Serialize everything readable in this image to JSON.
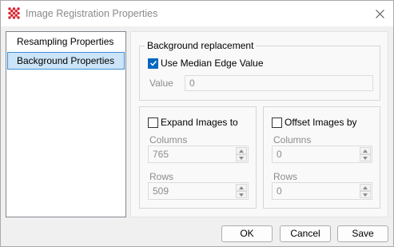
{
  "window": {
    "title": "Image Registration Properties"
  },
  "icons": {
    "app": "red-grid-app-icon",
    "close": "close-icon"
  },
  "sidebar": {
    "items": [
      {
        "label": "Resampling Properties",
        "selected": false
      },
      {
        "label": "Background Properties",
        "selected": true
      }
    ]
  },
  "background": {
    "group_title": "Background replacement",
    "use_median_label": "Use Median Edge Value",
    "use_median_checked": true,
    "value_label": "Value",
    "value": "0"
  },
  "expand": {
    "label": "Expand Images to",
    "checked": false,
    "columns_label": "Columns",
    "columns_value": "765",
    "rows_label": "Rows",
    "rows_value": "509"
  },
  "offset": {
    "label": "Offset Images by",
    "checked": false,
    "columns_label": "Columns",
    "columns_value": "0",
    "rows_label": "Rows",
    "rows_value": "0"
  },
  "buttons": {
    "ok": "OK",
    "cancel": "Cancel",
    "save": "Save"
  },
  "colors": {
    "accent": "#0067c0",
    "selection_bg": "#cce4f7",
    "selection_border": "#3d8fd6",
    "app_icon_red": "#d9232e"
  }
}
